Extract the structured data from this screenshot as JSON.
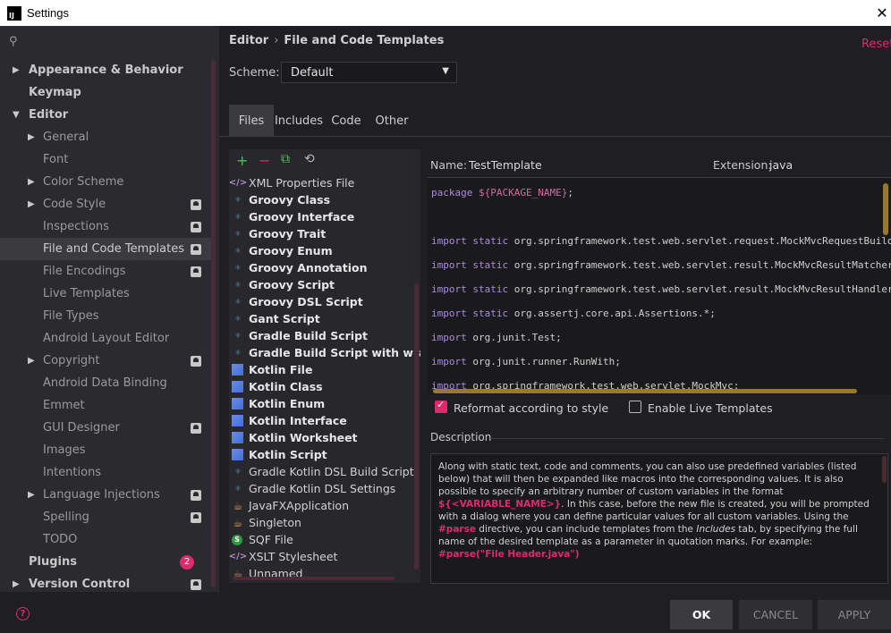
{
  "window": {
    "title": "Settings",
    "app_icon": "IJ"
  },
  "sidebar": {
    "search_placeholder": "",
    "items": [
      {
        "label": "Appearance & Behavior",
        "level": 0,
        "arrow": "▶"
      },
      {
        "label": "Keymap",
        "level": 0,
        "arrow": ""
      },
      {
        "label": "Editor",
        "level": 0,
        "arrow": "▼"
      },
      {
        "label": "General",
        "level": 1,
        "arrow": "▶"
      },
      {
        "label": "Font",
        "level": 1,
        "arrow": ""
      },
      {
        "label": "Color Scheme",
        "level": 1,
        "arrow": "▶"
      },
      {
        "label": "Code Style",
        "level": 1,
        "arrow": "▶",
        "badge": true
      },
      {
        "label": "Inspections",
        "level": 1,
        "arrow": "",
        "badge": true
      },
      {
        "label": "File and Code Templates",
        "level": 1,
        "arrow": "",
        "badge": true,
        "selected": true
      },
      {
        "label": "File Encodings",
        "level": 1,
        "arrow": "",
        "badge": true
      },
      {
        "label": "Live Templates",
        "level": 1,
        "arrow": ""
      },
      {
        "label": "File Types",
        "level": 1,
        "arrow": ""
      },
      {
        "label": "Android Layout Editor",
        "level": 1,
        "arrow": ""
      },
      {
        "label": "Copyright",
        "level": 1,
        "arrow": "▶",
        "badge": true
      },
      {
        "label": "Android Data Binding",
        "level": 1,
        "arrow": ""
      },
      {
        "label": "Emmet",
        "level": 1,
        "arrow": ""
      },
      {
        "label": "GUI Designer",
        "level": 1,
        "arrow": "",
        "badge": true
      },
      {
        "label": "Images",
        "level": 1,
        "arrow": ""
      },
      {
        "label": "Intentions",
        "level": 1,
        "arrow": ""
      },
      {
        "label": "Language Injections",
        "level": 1,
        "arrow": "▶",
        "badge": true
      },
      {
        "label": "Spelling",
        "level": 1,
        "arrow": "",
        "badge": true
      },
      {
        "label": "TODO",
        "level": 1,
        "arrow": ""
      },
      {
        "label": "Plugins",
        "level": 0,
        "arrow": "",
        "count": "2"
      },
      {
        "label": "Version Control",
        "level": 0,
        "arrow": "▶",
        "badge": true
      }
    ]
  },
  "header": {
    "breadcrumb": [
      "Editor",
      "File and Code Templates"
    ],
    "reset": "Reset",
    "scheme_label": "Scheme:",
    "scheme_value": "Default"
  },
  "tabs": [
    {
      "label": "Files",
      "active": true
    },
    {
      "label": "Includes",
      "active": false
    },
    {
      "label": "Code",
      "active": false
    },
    {
      "label": "Other",
      "active": false
    }
  ],
  "toolbar": {
    "add": "+",
    "remove": "−",
    "copy": "⧉",
    "reset": "⟲"
  },
  "templates": [
    {
      "label": "XML Properties File",
      "icon": "xml",
      "bold": false
    },
    {
      "label": "Groovy Class",
      "icon": "groovy",
      "bold": true
    },
    {
      "label": "Groovy Interface",
      "icon": "groovy",
      "bold": true
    },
    {
      "label": "Groovy Trait",
      "icon": "groovy",
      "bold": true
    },
    {
      "label": "Groovy Enum",
      "icon": "groovy",
      "bold": true
    },
    {
      "label": "Groovy Annotation",
      "icon": "groovy",
      "bold": true
    },
    {
      "label": "Groovy Script",
      "icon": "groovy",
      "bold": true
    },
    {
      "label": "Groovy DSL Script",
      "icon": "groovy",
      "bold": true
    },
    {
      "label": "Gant Script",
      "icon": "groovy",
      "bold": true
    },
    {
      "label": "Gradle Build Script",
      "icon": "groovy",
      "bold": true
    },
    {
      "label": "Gradle Build Script with wrapper",
      "icon": "groovy",
      "bold": true
    },
    {
      "label": "Kotlin File",
      "icon": "kotlin",
      "bold": true
    },
    {
      "label": "Kotlin Class",
      "icon": "kotlin",
      "bold": true
    },
    {
      "label": "Kotlin Enum",
      "icon": "kotlin",
      "bold": true
    },
    {
      "label": "Kotlin Interface",
      "icon": "kotlin",
      "bold": true
    },
    {
      "label": "Kotlin Worksheet",
      "icon": "kotlin",
      "bold": true
    },
    {
      "label": "Kotlin Script",
      "icon": "kotlin",
      "bold": true
    },
    {
      "label": "Gradle Kotlin DSL Build Script",
      "icon": "groovy",
      "bold": false
    },
    {
      "label": "Gradle Kotlin DSL Settings",
      "icon": "groovy",
      "bold": false
    },
    {
      "label": "JavaFXApplication",
      "icon": "java",
      "bold": false
    },
    {
      "label": "Singleton",
      "icon": "java",
      "bold": false
    },
    {
      "label": "SQF File",
      "icon": "sqf",
      "bold": false
    },
    {
      "label": "XSLT Stylesheet",
      "icon": "xml",
      "bold": false
    },
    {
      "label": "Unnamed",
      "icon": "java",
      "bold": false
    }
  ],
  "editor": {
    "name_label": "Name:",
    "name_value": "TestTemplate",
    "ext_label": "Extension:",
    "ext_value": "java",
    "lines": [
      {
        "kw": "package ",
        "rest": "",
        "var": "${PACKAGE_NAME}",
        "tail": ";"
      },
      {
        "kw": "",
        "rest": "",
        "var": "",
        "tail": ""
      },
      {
        "kw": "import static ",
        "rest": "org.springframework.test.web.servlet.request.MockMvcRequestBuilders.*;",
        "var": "",
        "tail": ""
      },
      {
        "kw": "import static ",
        "rest": "org.springframework.test.web.servlet.result.MockMvcResultMatchers.*;",
        "var": "",
        "tail": ""
      },
      {
        "kw": "import static ",
        "rest": "org.springframework.test.web.servlet.result.MockMvcResultHandlers.*;",
        "var": "",
        "tail": ""
      },
      {
        "kw": "import static ",
        "rest": "org.assertj.core.api.Assertions.*;",
        "var": "",
        "tail": ""
      },
      {
        "kw": "import ",
        "rest": "org.junit.Test;",
        "var": "",
        "tail": ""
      },
      {
        "kw": "import ",
        "rest": "org.junit.runner.RunWith;",
        "var": "",
        "tail": ""
      },
      {
        "kw": "import ",
        "rest": "org.springframework.test.web.servlet.MockMvc;",
        "var": "",
        "tail": ""
      }
    ],
    "reformat_label": "Reformat according to style",
    "reformat_checked": true,
    "live_label": "Enable Live Templates",
    "live_checked": false
  },
  "description": {
    "title": "Description",
    "p1": "Along with static text, code and comments, you can also use predefined variables (listed below) that will then be expanded like macros into the corresponding values. It is also possible to specify an arbitrary number of custom variables in the format",
    "var_format": "${<VARIABLE_NAME>}",
    "p2": ". In this case, before the new file is created, you will be prompted with a dialog where you can define particular values for all custom variables. Using the",
    "parse_kw": "#parse",
    "p3": "directive, you can include templates from the",
    "includes_word": "Includes",
    "p4": "tab, by specifying the full name of the desired template as a parameter in quotation marks. For example:",
    "example": "#parse(\"File Header.java\")"
  },
  "buttons": {
    "ok": "OK",
    "cancel": "CANCEL",
    "apply": "APPLY"
  },
  "colors": {
    "accent": "#e0296d",
    "bg": "#1f1f23",
    "sidebar": "#2b2b2f"
  }
}
